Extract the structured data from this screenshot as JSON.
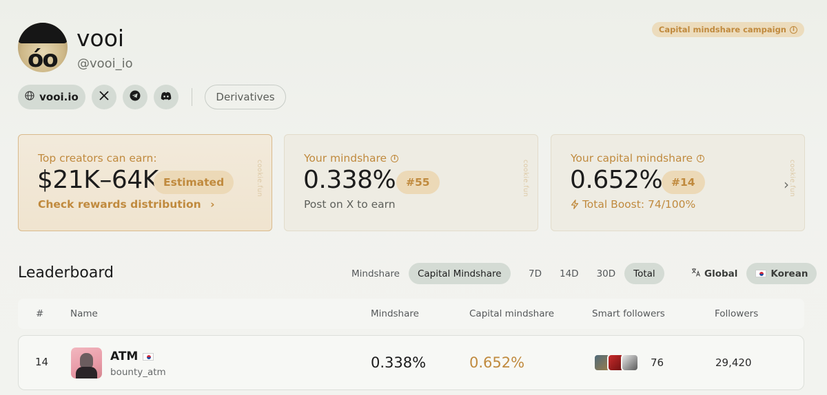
{
  "profile": {
    "name": "vooi",
    "handle": "@vooi_io",
    "avatar_text": "óo"
  },
  "campaign_badge": "Capital mindshare campaign",
  "links": {
    "website": "vooi.io",
    "category": "Derivatives",
    "icons": [
      "globe-icon",
      "x-icon",
      "telegram-icon",
      "discord-icon"
    ]
  },
  "cards": {
    "earn": {
      "label": "Top creators can earn:",
      "value": "$21K–64K",
      "tag": "Estimated",
      "link": "Check rewards distribution",
      "watermark": "cookie.fun"
    },
    "mindshare": {
      "label": "Your mindshare",
      "value": "0.338%",
      "rank": "#55",
      "sub": "Post on X to earn",
      "watermark": "cookie.fun"
    },
    "capital": {
      "label": "Your capital mindshare",
      "value": "0.652%",
      "rank": "#14",
      "boost": "Total Boost: 74/100%",
      "watermark": "cookie.fun"
    }
  },
  "leaderboard": {
    "title": "Leaderboard",
    "metric_tabs": [
      "Mindshare",
      "Capital Mindshare"
    ],
    "period_tabs": [
      "7D",
      "14D",
      "30D",
      "Total"
    ],
    "region_tabs": [
      "Global",
      "Korean"
    ],
    "active": {
      "metric": "Capital Mindshare",
      "period": "Total",
      "region": "Korean"
    },
    "columns": [
      "#",
      "Name",
      "Mindshare",
      "Capital mindshare",
      "Smart followers",
      "Followers"
    ],
    "rows": [
      {
        "rank": "14",
        "name": "ATM",
        "username": "bounty_atm",
        "mindshare": "0.338%",
        "capital_mindshare": "0.652%",
        "smart_followers": "76",
        "followers": "29,420"
      }
    ]
  },
  "colors": {
    "accent": "#c08a3e",
    "pill_bg": "#d4dbd4",
    "page_bg": "#f1f2ee"
  }
}
